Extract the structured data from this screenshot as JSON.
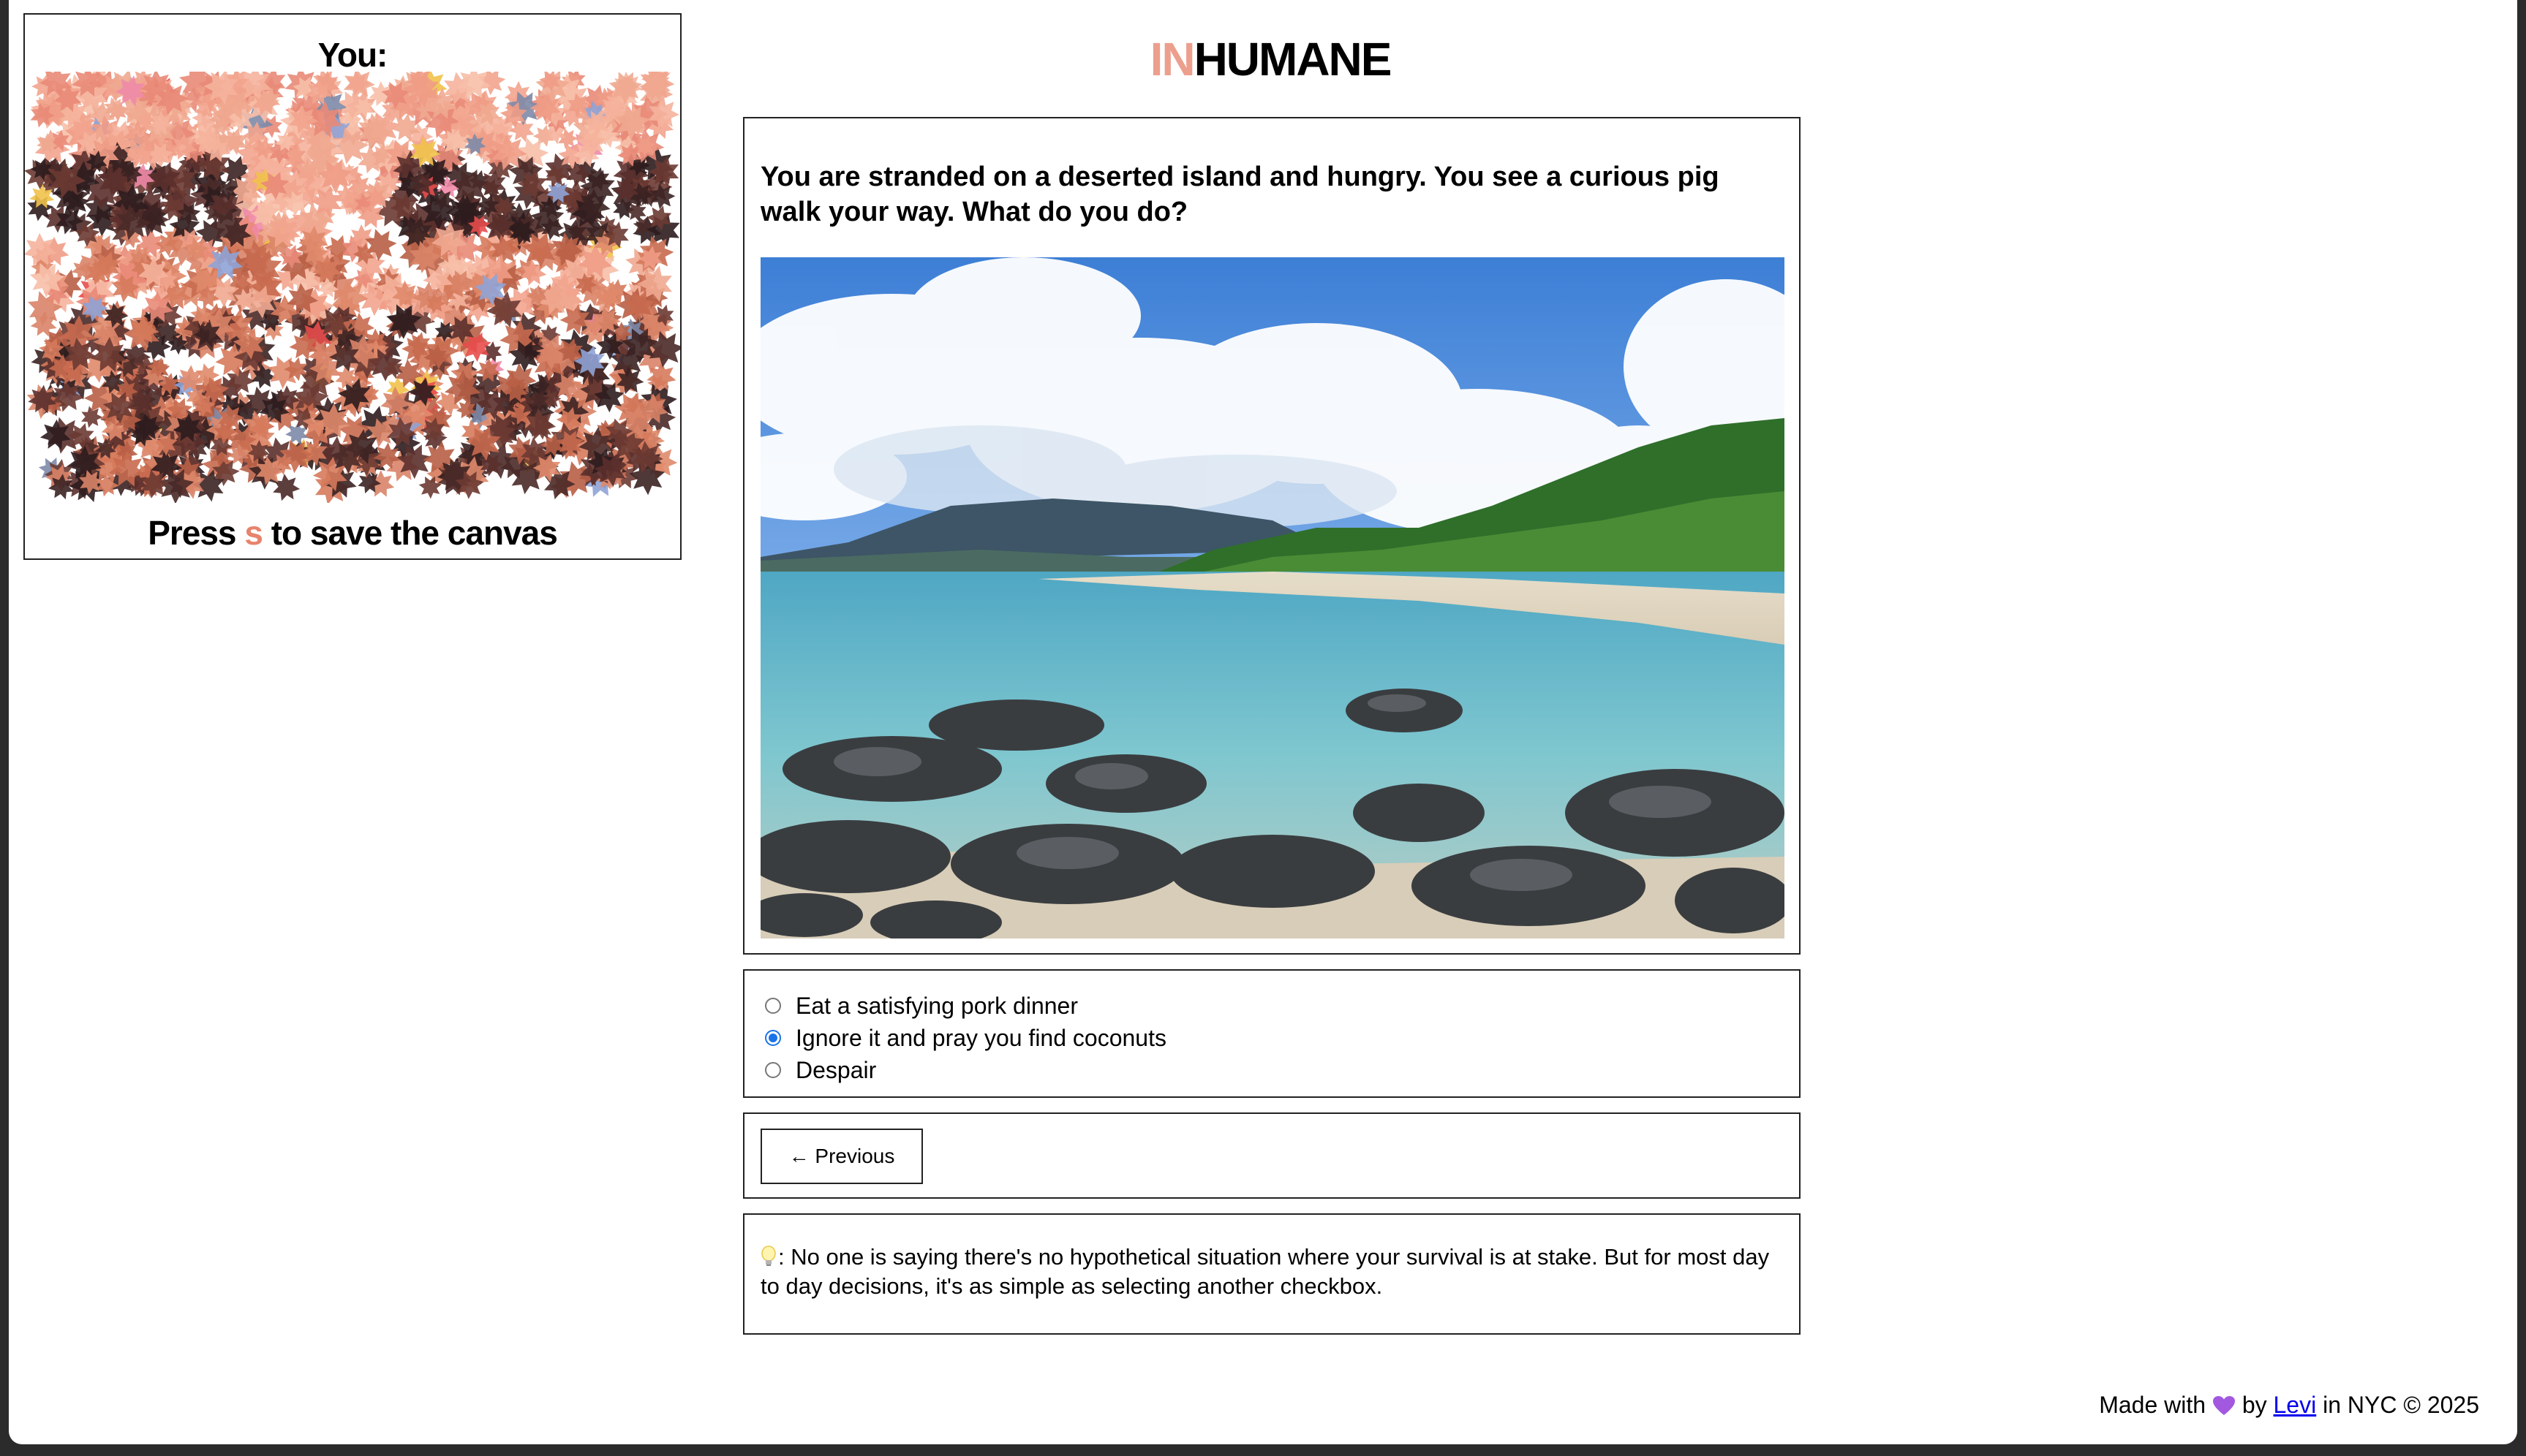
{
  "canvas_panel": {
    "title": "You:",
    "hint_prefix": "Press",
    "hint_key": "s",
    "hint_suffix": "to save the canvas",
    "art_icon": "star-mosaic-portrait"
  },
  "brand": {
    "accent": "IN",
    "rest": "HUMANE",
    "accent_color": "#ec9f8d"
  },
  "question": {
    "text": "You are stranded on a deserted island and hungry. You see a curious pig walk your way. What do you do?",
    "image_alt": "Tropical beach with rocks, turquoise water and a distant mountain"
  },
  "options": [
    {
      "label": "Eat a satisfying pork dinner",
      "checked": false
    },
    {
      "label": "Ignore it and pray you find coconuts",
      "checked": true
    },
    {
      "label": "Despair",
      "checked": false
    }
  ],
  "nav": {
    "previous_label": "← Previous"
  },
  "tip": {
    "icon": "lightbulb-icon",
    "text": ": No one is saying there's no hypothetical situation where your survival is at stake. But for most day to day decisions, it's as simple as selecting another checkbox."
  },
  "footer": {
    "prefix": "Made with",
    "heart_icon": "purple-heart-icon",
    "by": "by",
    "author": "Levi",
    "suffix": "in NYC © 2025"
  }
}
